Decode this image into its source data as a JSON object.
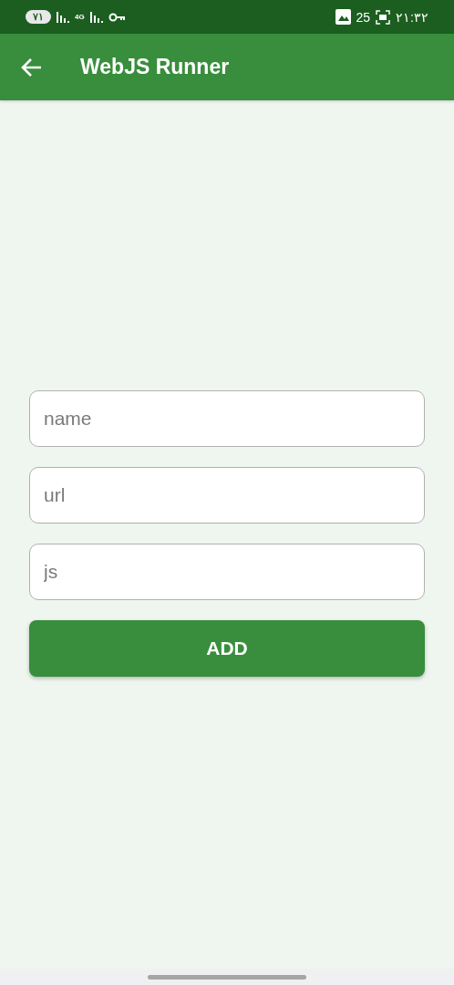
{
  "status_bar": {
    "battery": "٧١",
    "network": "4G",
    "notification_count": "25",
    "time": "٢١:٣٢"
  },
  "app_bar": {
    "title": "WebJS Runner"
  },
  "form": {
    "fields": [
      {
        "placeholder": "name"
      },
      {
        "placeholder": "url"
      },
      {
        "placeholder": "js"
      }
    ],
    "button": "ADD"
  }
}
